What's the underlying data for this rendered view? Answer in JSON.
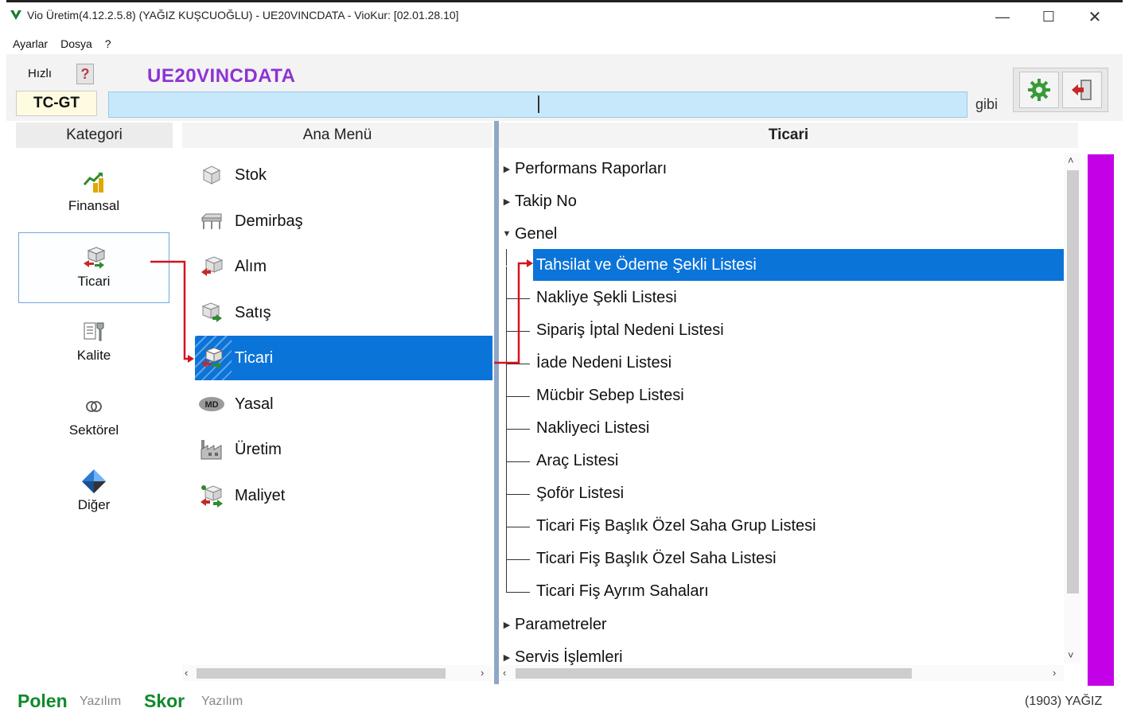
{
  "window": {
    "title": "Vio Üretim(4.12.2.5.8) (YAĞIZ KUŞCUOĞLU) - UE20VINCDATA - VioKur: [02.01.28.10]",
    "minimize": "—",
    "maximize": "☐",
    "close": "✕"
  },
  "menubar": {
    "items": [
      "Ayarlar",
      "Dosya",
      "?"
    ]
  },
  "toolbar": {
    "hizli_label": "Hızlı",
    "help_label": "?",
    "database_name": "UE20VINCDATA",
    "code": "TC-GT",
    "search_value": "",
    "search_mode": "gibi"
  },
  "columns": {
    "kategori": "Kategori",
    "ana_menu": "Ana Menü",
    "ticari": "Ticari"
  },
  "categories": [
    {
      "label": "Finansal",
      "icon": "finance-chart-icon"
    },
    {
      "label": "Ticari",
      "icon": "trade-boxes-icon",
      "selected": true
    },
    {
      "label": "Kalite",
      "icon": "quality-tools-icon"
    },
    {
      "label": "Sektörel",
      "icon": "sector-rings-icon"
    },
    {
      "label": "Diğer",
      "icon": "other-diamond-icon"
    }
  ],
  "main_menu": [
    {
      "label": "Stok",
      "icon": "box-icon"
    },
    {
      "label": "Demirbaş",
      "icon": "desk-icon"
    },
    {
      "label": "Alım",
      "icon": "purchase-icon"
    },
    {
      "label": "Satış",
      "icon": "sales-icon"
    },
    {
      "label": "Ticari",
      "icon": "trade-icon",
      "selected": true
    },
    {
      "label": "Yasal",
      "icon": "legal-md-icon"
    },
    {
      "label": "Üretim",
      "icon": "factory-icon"
    },
    {
      "label": "Maliyet",
      "icon": "cost-icon"
    }
  ],
  "tree": {
    "top_nodes": [
      "Performans Raporları",
      "Takip No"
    ],
    "expanded_node": "Genel",
    "children": [
      "Tahsilat ve Ödeme Şekli Listesi",
      "Nakliye Şekli Listesi",
      "Sipariş İptal Nedeni Listesi",
      "İade Nedeni Listesi",
      "Mücbir Sebep Listesi",
      "Nakliyeci Listesi",
      "Araç Listesi",
      "Şoför Listesi",
      "Ticari Fiş Başlık Özel Saha Grup Listesi",
      "Ticari Fiş Başlık Özel Saha Listesi",
      "Ticari Fiş Ayrım Sahaları"
    ],
    "selected_child": "Tahsilat ve Ödeme Şekli Listesi",
    "bottom_nodes": [
      "Parametreler",
      "Servis İşlemleri"
    ]
  },
  "status": {
    "brand1": "Polen",
    "brand1_sub": "Yazılım",
    "brand2": "Skor",
    "brand2_sub": "Yazılım",
    "user": "(1903) YAĞIZ"
  },
  "colors": {
    "selection": "#0b74d9",
    "accent_purple": "#8e32d4",
    "side_bar": "#c400e6",
    "brand_green": "#0f8a2b",
    "annotation_red": "#d4141e"
  }
}
